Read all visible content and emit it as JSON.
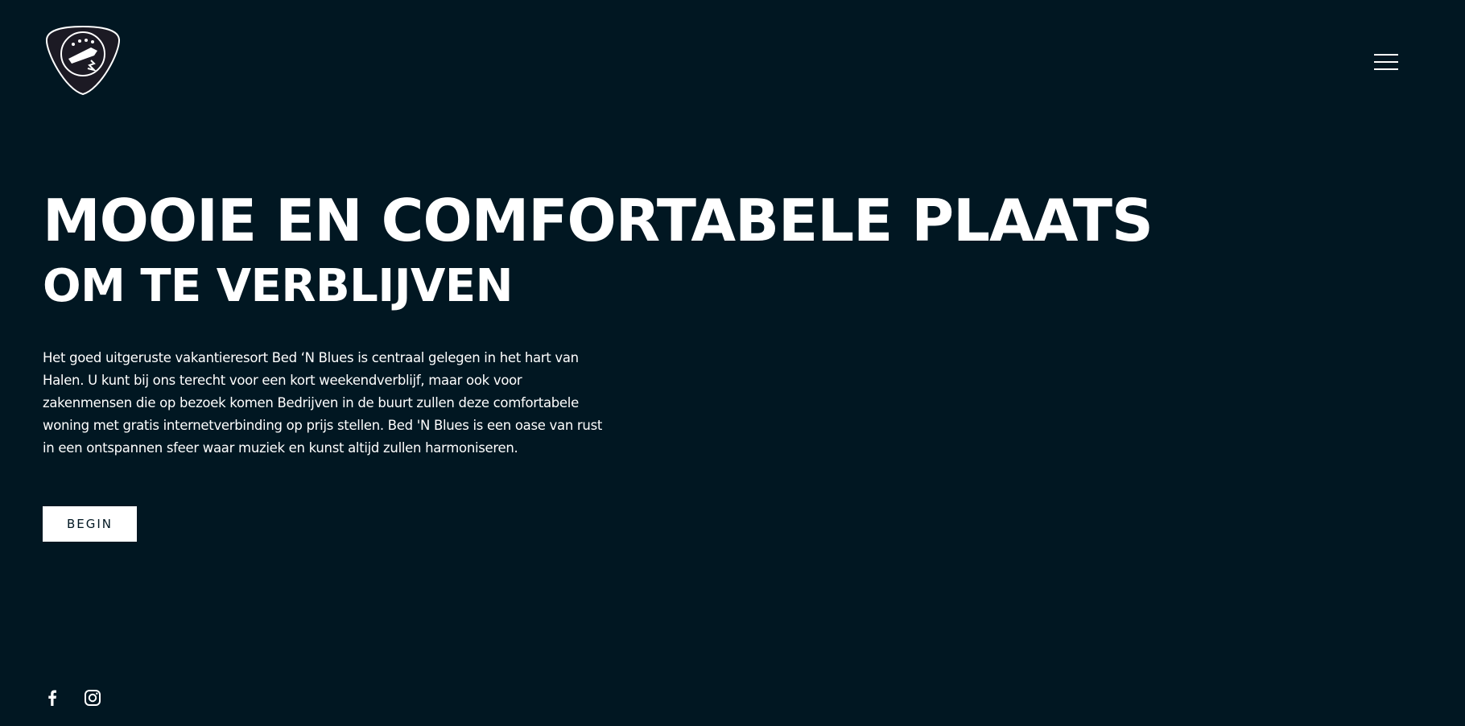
{
  "header": {
    "logo_icon": "guitar-pick-logo",
    "menu_icon": "hamburger-menu-icon"
  },
  "hero": {
    "title_line1": "MOOIE EN COMFORTABELE PLAATS",
    "title_line2": "OM TE VERBLIJVEN",
    "description": "Het goed uitgeruste vakantieresort Bed ‘N Blues is centraal gelegen in het hart van Halen. U kunt bij ons terecht voor een kort weekendverblijf, maar ook voor zakenmensen die op bezoek komen Bedrijven in de buurt zullen deze comfortabele woning met gratis internetverbinding op prijs stellen. Bed 'N Blues is een oase van rust in een ontspannen sfeer waar muziek en kunst altijd zullen harmoniseren.",
    "button_label": "BEGIN"
  },
  "social": {
    "items": [
      {
        "icon": "facebook-icon"
      },
      {
        "icon": "instagram-icon"
      }
    ]
  },
  "colors": {
    "background": "#011722",
    "text": "#ffffff",
    "button_bg": "#ffffff",
    "button_text": "#011722"
  }
}
